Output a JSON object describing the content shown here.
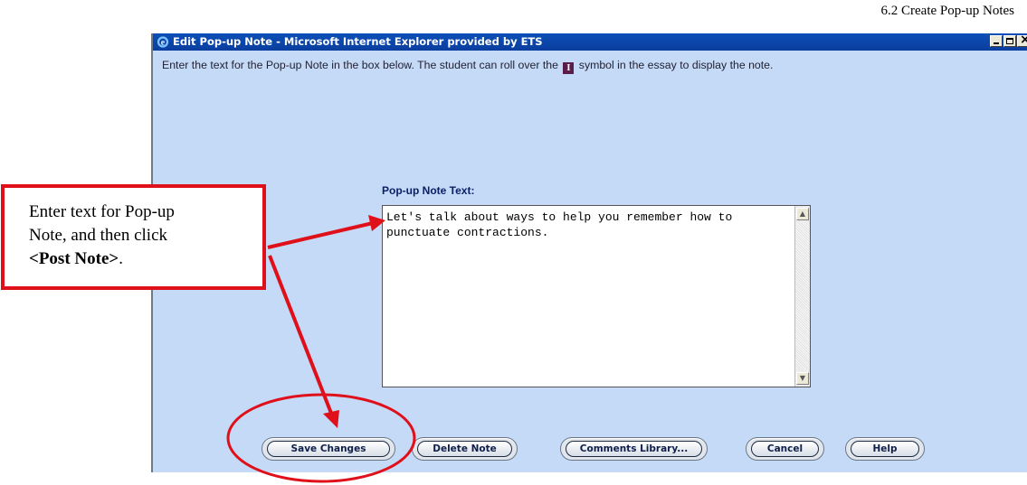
{
  "doc_header": "6.2 Create Pop-up Notes",
  "window": {
    "title": "Edit Pop-up Note - Microsoft Internet Explorer provided by ETS",
    "instructions_before": "Enter the text for the Pop-up Note in the box below. The student can roll over the",
    "instructions_symbol": "I",
    "instructions_after": "symbol in the essay to display the note."
  },
  "note_field": {
    "label": "Pop-up Note Text:",
    "value": "Let's talk about ways to help you remember how to punctuate contractions."
  },
  "buttons": {
    "save": "Save Changes",
    "delete": "Delete Note",
    "comments_library": "Comments Library...",
    "cancel": "Cancel",
    "help": "Help"
  },
  "callout": {
    "line1": "Enter text for Pop-up",
    "line2": "Note, and then click",
    "line3_bold": "<Post Note>",
    "line3_tail": "."
  },
  "colors": {
    "annotation_red": "#e0101a",
    "window_background": "#c5daf7",
    "titlebar_blue": "#0d4fb8"
  },
  "icons": [
    "ie-icon",
    "minimize-icon",
    "maximize-icon",
    "close-icon",
    "scroll-up-icon",
    "scroll-down-icon"
  ]
}
